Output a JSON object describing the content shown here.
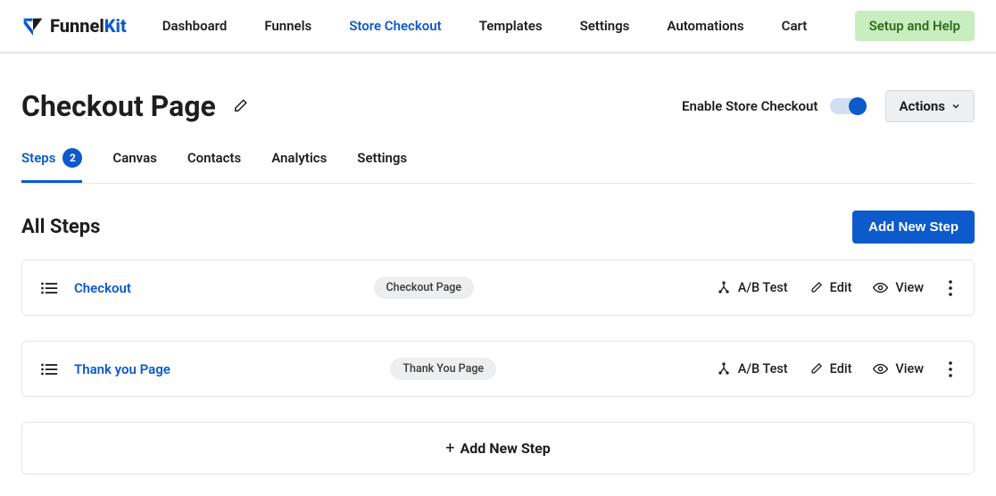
{
  "logo": {
    "name": "FunnelKit",
    "part1": "Funnel",
    "part2": "Kit"
  },
  "nav": {
    "items": [
      "Dashboard",
      "Funnels",
      "Store Checkout",
      "Templates",
      "Settings",
      "Automations",
      "Cart"
    ],
    "active_index": 2,
    "setup_help": "Setup and Help"
  },
  "header": {
    "title": "Checkout Page",
    "toggle_label": "Enable Store Checkout",
    "toggle_on": true,
    "actions_label": "Actions"
  },
  "tabs": {
    "items": [
      {
        "label": "Steps",
        "badge": "2"
      },
      {
        "label": "Canvas"
      },
      {
        "label": "Contacts"
      },
      {
        "label": "Analytics"
      },
      {
        "label": "Settings"
      }
    ],
    "active_index": 0
  },
  "section": {
    "title": "All Steps",
    "add_button": "Add New Step"
  },
  "steps": [
    {
      "name": "Checkout",
      "pill": "Checkout Page"
    },
    {
      "name": "Thank you Page",
      "pill": "Thank You Page"
    }
  ],
  "step_actions": {
    "ab": "A/B Test",
    "edit": "Edit",
    "view": "View"
  },
  "add_bar": "Add New Step",
  "icons": {
    "pencil": "pencil-icon",
    "chevron_down": "chevron-down-icon",
    "drag": "drag-icon",
    "ab": "split-icon",
    "eye": "eye-icon",
    "more": "more-icon"
  }
}
